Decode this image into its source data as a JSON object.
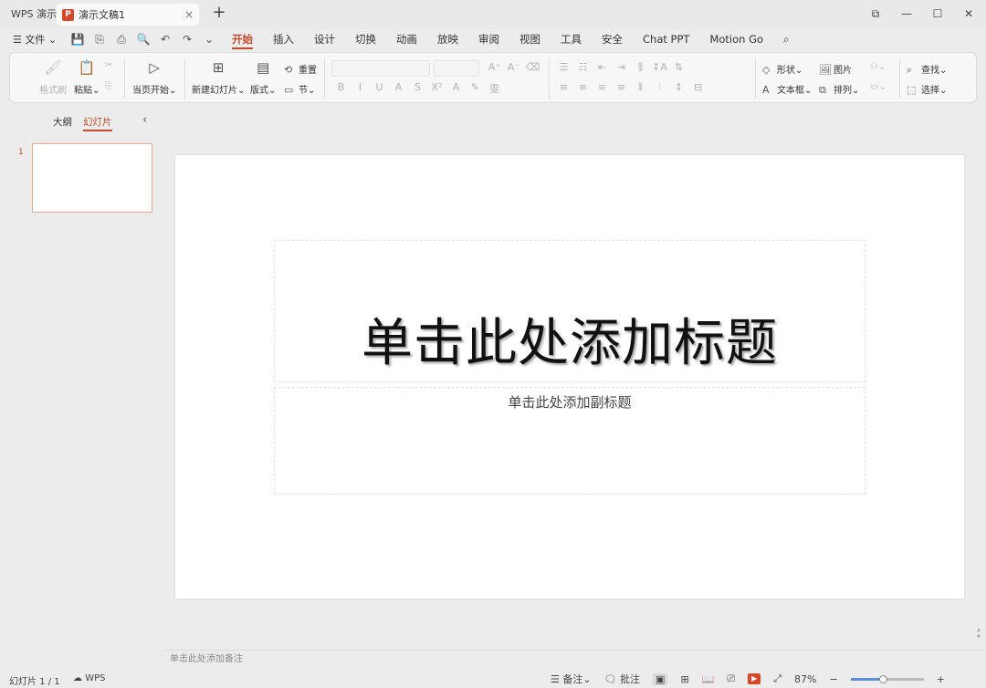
{
  "titlebar": {
    "app_tab": "WPS 演示",
    "doc_title": "演示文稿1",
    "doc_icon_letter": "P",
    "close": "×",
    "new_tab": "+",
    "win_buttons": [
      "⧉",
      "—",
      "☐",
      "✕"
    ]
  },
  "menu": {
    "file": "☰ 文件 ⌄",
    "quick_icons": [
      "💾",
      "⎘",
      "⎙",
      "🔍",
      "↶",
      "↷",
      "⌄"
    ],
    "tabs": [
      "开始",
      "插入",
      "设计",
      "切换",
      "动画",
      "放映",
      "审阅",
      "视图",
      "工具",
      "安全",
      "Chat PPT",
      "Motion Go"
    ],
    "active_tab": "开始",
    "search_icon": "⌕"
  },
  "ribbon": {
    "format_painter": "格式刷",
    "paste": "粘贴⌄",
    "play_from_current": "当页开始⌄",
    "new_slide": "新建幻灯片⌄",
    "layout": "版式⌄",
    "reset": "重置",
    "section": "节⌄",
    "shape": "形状⌄",
    "picture": "图片",
    "textbox": "文本框⌄",
    "arrange": "排列⌄",
    "find": "查找⌄",
    "select": "选择⌄",
    "font_buttons": [
      "B",
      "I",
      "U",
      "A",
      "S",
      "X²",
      "A",
      "✎",
      "雯"
    ],
    "para_buttons": [
      "≡",
      "≡",
      "≡",
      "≡",
      "⫴",
      "⫶",
      "↕",
      "⊟"
    ],
    "list_buttons": [
      "☰",
      "☷",
      "⇤",
      "⇥",
      "⫼",
      "↕A",
      "⇅"
    ],
    "grow_shrink": [
      "A⁺",
      "A⁻",
      "⌫"
    ]
  },
  "left_pane": {
    "tab_outline": "大纲",
    "tab_slides": "幻灯片",
    "collapse": "‹",
    "slide_number": "1"
  },
  "slide": {
    "title_placeholder": "单击此处添加标题",
    "subtitle_placeholder": "单击此处添加副标题"
  },
  "notes": {
    "placeholder": "单击此处添加备注"
  },
  "status": {
    "slide_counter": "幻灯片 1 / 1",
    "wps_label": "WPS",
    "notes_btn": "备注⌄",
    "comments_btn": "批注",
    "zoom": "87%",
    "zoom_fraction": 0.45
  }
}
